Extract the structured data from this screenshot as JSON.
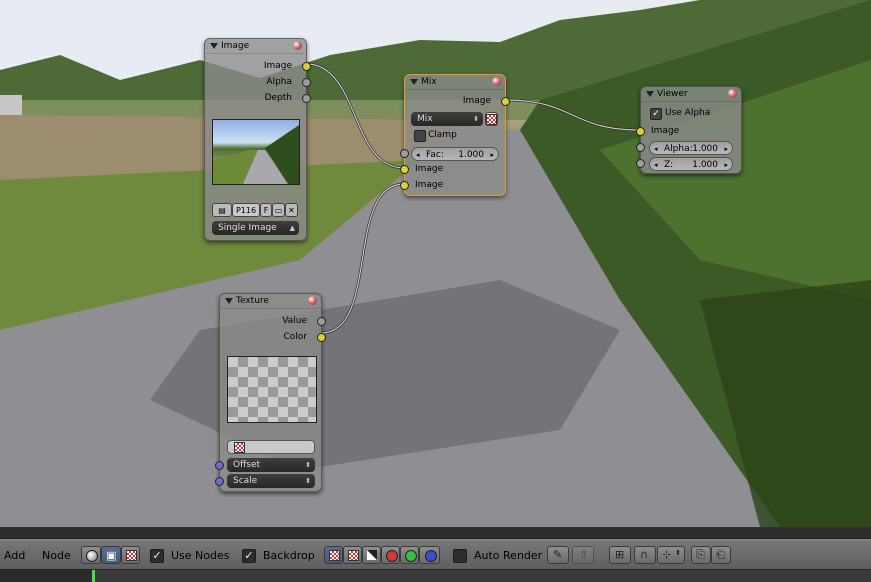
{
  "nodes": {
    "image": {
      "title": "Image",
      "outputs": [
        "Image",
        "Alpha",
        "Depth"
      ],
      "datablock_name": "P116",
      "fake_user": "F",
      "source": "Single Image"
    },
    "mix": {
      "title": "Mix",
      "output": "Image",
      "blend_mode": "Mix",
      "clamp_label": "Clamp",
      "fac_label": "Fac:",
      "fac_value": "1.000",
      "inputs": [
        "Image",
        "Image"
      ]
    },
    "viewer": {
      "title": "Viewer",
      "use_alpha_label": "Use Alpha",
      "input": "Image",
      "alpha_label": "Alpha:",
      "alpha_value": "1.000",
      "z_label": "Z:",
      "z_value": "1.000"
    },
    "texture": {
      "title": "Texture",
      "outputs": [
        "Value",
        "Color"
      ],
      "inputs": [
        "Offset",
        "Scale"
      ]
    }
  },
  "header": {
    "menus": [
      "Add",
      "Node"
    ],
    "use_nodes_label": "Use Nodes",
    "backdrop_label": "Backdrop",
    "auto_render_label": "Auto Render"
  },
  "colors": {
    "socket_color": "#d8d034",
    "socket_value": "#9c9c9c",
    "socket_vector": "#6b6bd8",
    "active_node_outline": "#e79a2e",
    "header_bg": "#6b6b6b",
    "playhead": "#3ee63e"
  },
  "icons": [
    "collapse-triangle-icon",
    "node-preview-ball-icon",
    "checker-texture-icon",
    "image-browse-icon",
    "folder-icon",
    "close-icon",
    "shader-tree-icon",
    "compositor-tree-icon",
    "texture-tree-icon",
    "pin-icon",
    "parent-icon",
    "snap-icon",
    "magnet-icon",
    "copy-icon",
    "paste-icon"
  ]
}
